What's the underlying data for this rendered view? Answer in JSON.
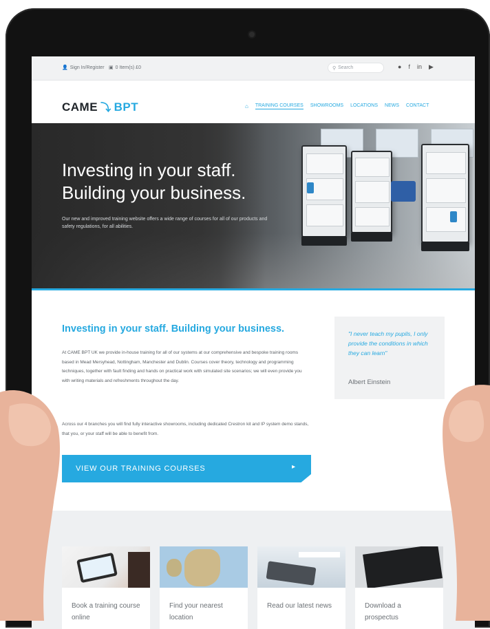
{
  "utility": {
    "login_label": "Sign In/Register",
    "basket_label": "0 Item(s) £0",
    "search_placeholder": "Search"
  },
  "header": {
    "logo_came": "CAME",
    "logo_bpt": "BPT"
  },
  "nav": {
    "items": [
      "TRAINING COURSES",
      "SHOWROOMS",
      "LOCATIONS",
      "NEWS",
      "CONTACT"
    ]
  },
  "hero": {
    "title_line1": "Investing in your staff.",
    "title_line2": "Building your business.",
    "subtitle": "Our new and improved training website offers a wide range of courses for all of our products and safety regulations, for all abilities."
  },
  "main": {
    "heading": "Investing in your staff. Building your business.",
    "paragraph1": "At CAME BPT UK we provide in-house training for all of our systems at our comprehensive and bespoke training rooms based in Mead Mersyhead, Nottingham, Manchester and Dublin. Courses cover theory, technology and programming techniques, together with fault finding and hands on practical work with simulated site scenarios; we will even provide you with writing materials and refreshments throughout the day.",
    "paragraph2": "Across our 4 branches you will find fully interactive showrooms, including dedicated Crestron kit and IP system demo stands, that you, or your staff will be able to benefit from.",
    "cta_label": "VIEW OUR TRAINING COURSES"
  },
  "quote": {
    "text": "\"I never teach my pupils, I only provide the conditions in which they can learn\"",
    "author": "Albert Einstein"
  },
  "cards": [
    {
      "label": "Book a training course online"
    },
    {
      "label": "Find your nearest location"
    },
    {
      "label": "Read our latest news"
    },
    {
      "label": "Download a prospectus"
    }
  ],
  "colors": {
    "accent": "#26a9e0",
    "hero_dark": "#3b3b3b",
    "strip_bg": "#eef0f2"
  }
}
